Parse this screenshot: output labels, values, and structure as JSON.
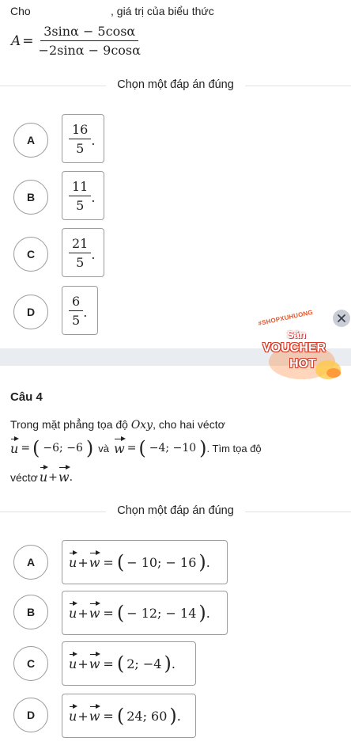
{
  "question3": {
    "prefix": "Cho",
    "suffix": ", giá trị của biểu thức",
    "expr_lhs": "A",
    "expr_eq": "=",
    "expr_num": "3sinα − 5cosα",
    "expr_den": "−2sinα − 9cosα",
    "choose_label": "Chọn một đáp án đúng",
    "options": [
      {
        "letter": "A",
        "num": "16",
        "den": "5"
      },
      {
        "letter": "B",
        "num": "11",
        "den": "5"
      },
      {
        "letter": "C",
        "num": "21",
        "den": "5"
      },
      {
        "letter": "D",
        "num": "6",
        "den": "5"
      }
    ]
  },
  "promo": {
    "hashtag": "#SHOPXUHUONG",
    "line1": "Săn",
    "line2": "VOUCHER",
    "line3": "HOT"
  },
  "question4": {
    "title": "Câu 4",
    "line1_a": "Trong mặt phẳng tọa độ",
    "line1_oxy": "Oxy",
    "line1_b": ", cho hai véctơ",
    "u_name": "u",
    "w_name": "w",
    "u_value": "−6; −6",
    "w_value": "−4; −10",
    "and_word": "và",
    "line2_end": ". Tìm tọa độ",
    "line3_a": "véctơ",
    "choose_label": "Chọn một đáp án đúng",
    "options": [
      {
        "letter": "A",
        "value": "− 10; − 16"
      },
      {
        "letter": "B",
        "value": "− 12; − 14"
      },
      {
        "letter": "C",
        "value": "2; −4"
      },
      {
        "letter": "D",
        "value": "24; 60"
      }
    ]
  }
}
